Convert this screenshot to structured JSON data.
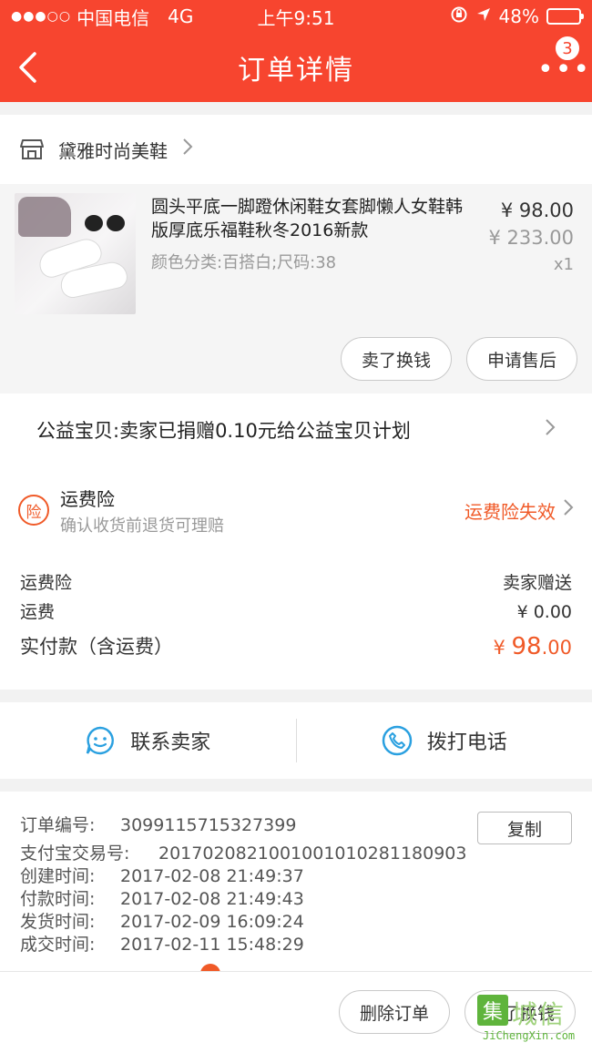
{
  "status_bar": {
    "carrier": "中国电信",
    "network": "4G",
    "time": "上午9:51",
    "battery": "48%",
    "battery_level": 0.48
  },
  "header": {
    "back_label": "<",
    "title": "订单详情",
    "more_label": "•••",
    "badge_count": "3"
  },
  "shop": {
    "name": "黛雅时尚美鞋"
  },
  "product": {
    "title": "圆头平底一脚蹬休闲鞋女套脚懒人女鞋韩版厚底乐福鞋秋冬2016新款",
    "variant": "颜色分类:百搭白;尺码:38",
    "price": "¥ 98.00",
    "original_price": "¥ 233.00",
    "quantity": "x1",
    "actions": [
      "卖了换钱",
      "申请售后"
    ]
  },
  "charity": {
    "text": "公益宝贝:卖家已捐赠0.10元给公益宝贝计划"
  },
  "insurance": {
    "icon_char": "险",
    "title": "运费险",
    "subtitle": "确认收货前退货可理赔",
    "status": "运费险失效"
  },
  "fees": {
    "rows": [
      {
        "label": "运费险",
        "value": "卖家赠送"
      },
      {
        "label": "运费",
        "value": "¥ 0.00"
      }
    ],
    "total_label": "实付款（含运费）",
    "total_currency": "¥ ",
    "total_int": "98",
    "total_dec": ".00"
  },
  "contact": {
    "seller_label": "联系卖家",
    "phone_label": "拨打电话"
  },
  "order_info": {
    "order_no_label": "订单编号:",
    "order_no": "3099115715327399",
    "copy_label": "复制",
    "alipay_label": "支付宝交易号:",
    "alipay_no": "2017020821001001010281180903",
    "rows": [
      {
        "label": "创建时间:",
        "value": "2017-02-08 21:49:37"
      },
      {
        "label": "付款时间:",
        "value": "2017-02-08 21:49:43"
      },
      {
        "label": "发货时间:",
        "value": "2017-02-09 16:09:24"
      },
      {
        "label": "成交时间:",
        "value": "2017-02-11 15:48:29"
      }
    ]
  },
  "bottom_bar": {
    "actions": [
      "删除订单",
      "卖了换钱"
    ]
  },
  "watermark": {
    "box_char": "集",
    "text": "城信",
    "url": "JiChengXin.com"
  },
  "colors": {
    "brand": "#f7452f",
    "accent_orange": "#f05a28",
    "contact_blue": "#2aa0e0"
  }
}
